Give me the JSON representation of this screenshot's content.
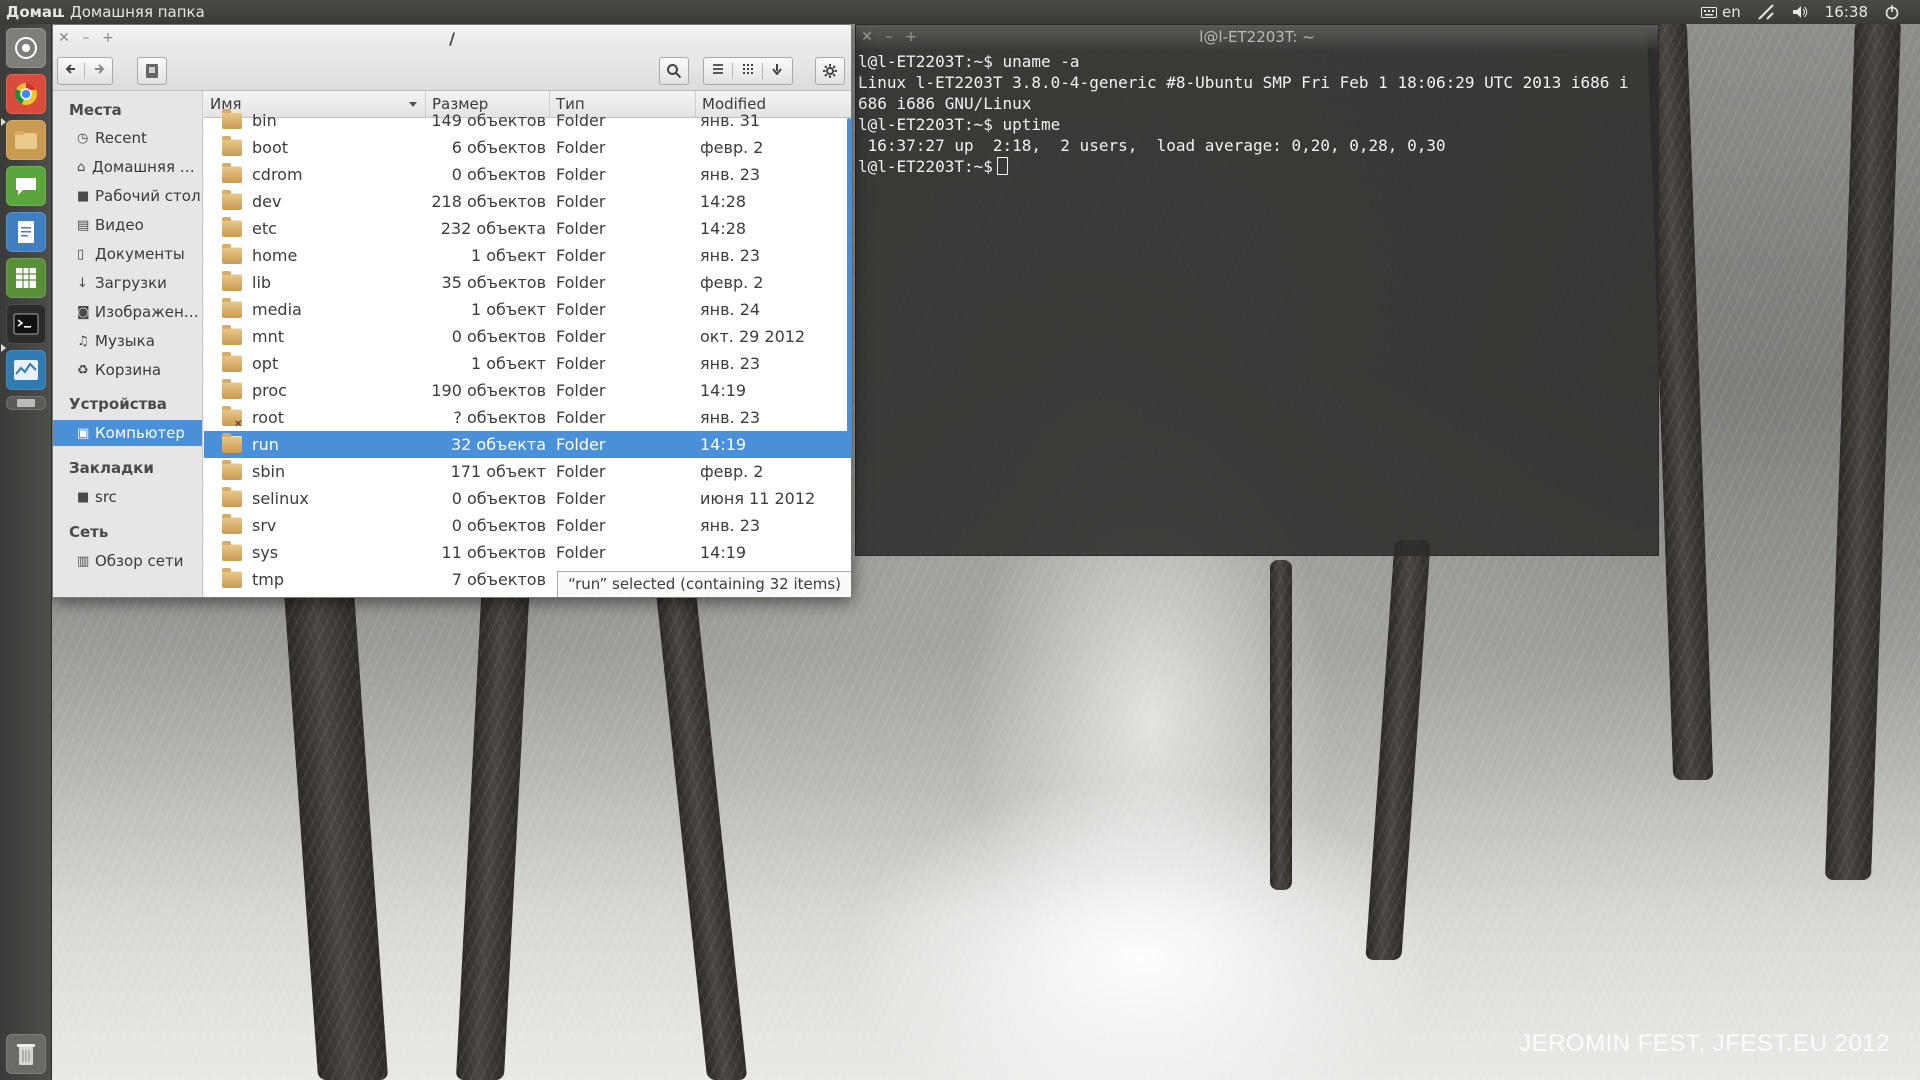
{
  "top_panel": {
    "app_short": "Домашняя папка",
    "app_title": "Домашняя папка",
    "keyboard_layout": "en",
    "clock": "16:38"
  },
  "launcher": {
    "items": [
      {
        "icon": "dash-home-icon",
        "color": "#7e7e7b"
      },
      {
        "icon": "chrome-icon",
        "color": "#d94b3a"
      },
      {
        "icon": "files-icon",
        "color": "#c99a52"
      },
      {
        "icon": "chat-icon",
        "color": "#5aa63c"
      },
      {
        "icon": "writer-icon",
        "color": "#3f7fbf"
      },
      {
        "icon": "calc-icon",
        "color": "#5a8f3a"
      },
      {
        "icon": "terminal-icon",
        "color": "#2c2c2a"
      },
      {
        "icon": "system-monitor-icon",
        "color": "#2f7ab0"
      }
    ],
    "trash_icon": "trash-icon"
  },
  "file_manager": {
    "title": "/",
    "sidebar": {
      "places_header": "Места",
      "places": [
        {
          "icon": "clock-icon",
          "label": "Recent"
        },
        {
          "icon": "home-icon",
          "label": "Домашняя папка"
        },
        {
          "icon": "folder-icon",
          "label": "Рабочий стол"
        },
        {
          "icon": "video-icon",
          "label": "Видео"
        },
        {
          "icon": "document-icon",
          "label": "Документы"
        },
        {
          "icon": "download-icon",
          "label": "Загрузки"
        },
        {
          "icon": "camera-icon",
          "label": "Изображения"
        },
        {
          "icon": "music-icon",
          "label": "Музыка"
        },
        {
          "icon": "trash-icon",
          "label": "Корзина"
        }
      ],
      "devices_header": "Устройства",
      "devices": [
        {
          "icon": "computer-icon",
          "label": "Компьютер"
        }
      ],
      "bookmarks_header": "Закладки",
      "bookmarks": [
        {
          "icon": "folder-icon",
          "label": "src"
        }
      ],
      "network_header": "Сеть",
      "network": [
        {
          "icon": "network-icon",
          "label": "Обзор сети"
        }
      ]
    },
    "columns": {
      "name": "Имя",
      "size": "Размер",
      "type": "Тип",
      "modified": "Modified"
    },
    "rows": [
      {
        "name": "bin",
        "size": "149 объектов",
        "type": "Folder",
        "modified": "янв. 31"
      },
      {
        "name": "boot",
        "size": "6 объектов",
        "type": "Folder",
        "modified": "февр. 2"
      },
      {
        "name": "cdrom",
        "size": "0 объектов",
        "type": "Folder",
        "modified": "янв. 23"
      },
      {
        "name": "dev",
        "size": "218 объектов",
        "type": "Folder",
        "modified": "14:28"
      },
      {
        "name": "etc",
        "size": "232 объекта",
        "type": "Folder",
        "modified": "14:28"
      },
      {
        "name": "home",
        "size": "1 объект",
        "type": "Folder",
        "modified": "янв. 23"
      },
      {
        "name": "lib",
        "size": "35 объектов",
        "type": "Folder",
        "modified": "февр. 2"
      },
      {
        "name": "media",
        "size": "1 объект",
        "type": "Folder",
        "modified": "янв. 24"
      },
      {
        "name": "mnt",
        "size": "0 объектов",
        "type": "Folder",
        "modified": "окт. 29 2012"
      },
      {
        "name": "opt",
        "size": "1 объект",
        "type": "Folder",
        "modified": "янв. 23"
      },
      {
        "name": "proc",
        "size": "190 объектов",
        "type": "Folder",
        "modified": "14:19"
      },
      {
        "name": "root",
        "size": "? объектов",
        "type": "Folder",
        "modified": "янв. 23"
      },
      {
        "name": "run",
        "size": "32 объекта",
        "type": "Folder",
        "modified": "14:19"
      },
      {
        "name": "sbin",
        "size": "171 объект",
        "type": "Folder",
        "modified": "февр. 2"
      },
      {
        "name": "selinux",
        "size": "0 объектов",
        "type": "Folder",
        "modified": "июня 11 2012"
      },
      {
        "name": "srv",
        "size": "0 объектов",
        "type": "Folder",
        "modified": "янв. 23"
      },
      {
        "name": "sys",
        "size": "11 объектов",
        "type": "Folder",
        "modified": "14:19"
      },
      {
        "name": "tmp",
        "size": "7 объектов",
        "type": "Folder",
        "modified": ""
      }
    ],
    "selected_row": "run",
    "status": "“run” selected (containing 32 items)"
  },
  "terminal": {
    "title": "l@l-ET2203T: ~",
    "lines": [
      "l@l-ET2203T:~$ uname -a",
      "Linux l-ET2203T 3.8.0-4-generic #8-Ubuntu SMP Fri Feb 1 18:06:29 UTC 2013 i686 i",
      "686 i686 GNU/Linux",
      "l@l-ET2203T:~$ uptime",
      " 16:37:27 up  2:18,  2 users,  load average: 0,20, 0,28, 0,30",
      "l@l-ET2203T:~$"
    ]
  },
  "wallpaper": {
    "watermark": "JEROMIN FEST, JFEST.EU 2012"
  }
}
